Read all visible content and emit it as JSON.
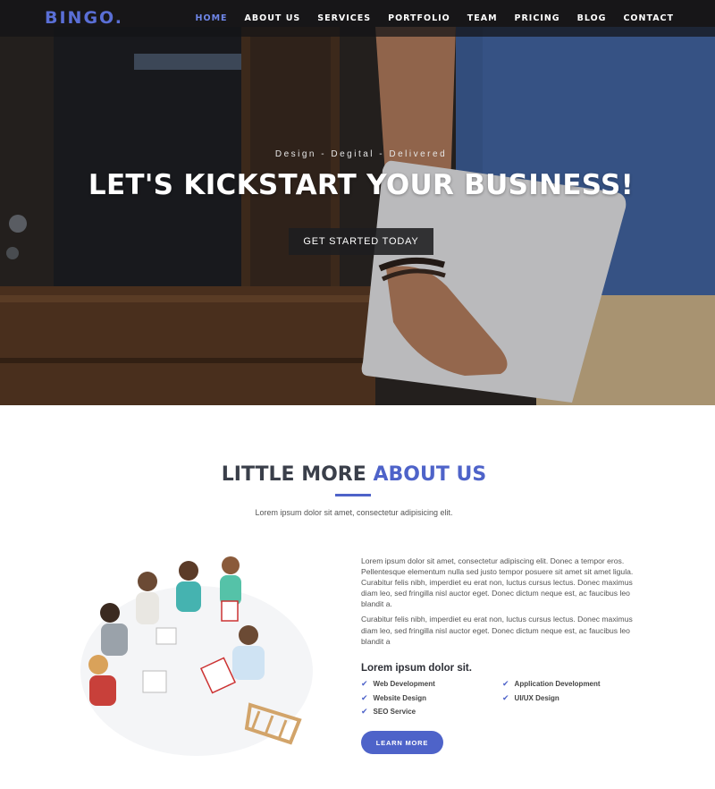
{
  "brand": {
    "logo": "BINGO.",
    "accent_color": "#4e63c9"
  },
  "nav": {
    "items": [
      {
        "label": "HOME",
        "active": true
      },
      {
        "label": "ABOUT US",
        "active": false
      },
      {
        "label": "SERVICES",
        "active": false
      },
      {
        "label": "PORTFOLIO",
        "active": false
      },
      {
        "label": "TEAM",
        "active": false
      },
      {
        "label": "PRICING",
        "active": false
      },
      {
        "label": "BLOG",
        "active": false
      },
      {
        "label": "CONTACT",
        "active": false
      }
    ]
  },
  "hero": {
    "tagline": "Design - Degital - Delivered",
    "headline": "LET'S KICKSTART YOUR BUSINESS!",
    "cta_label": "GET STARTED TODAY"
  },
  "about": {
    "title_prefix": "LITTLE MORE",
    "title_accent": "ABOUT US",
    "subtitle": "Lorem ipsum dolor sit amet, consectetur adipisicing elit.",
    "paragraphs": [
      "Lorem ipsum dolor sit amet, consectetur adipiscing elit. Donec a tempor eros. Pellentesque elementum nulla sed justo tempor posuere sit amet sit amet ligula. Curabitur felis nibh, imperdiet eu erat non, luctus cursus lectus. Donec maximus diam leo, sed fringilla nisl auctor eget. Donec dictum neque est, ac faucibus leo blandit a.",
      "Curabitur felis nibh, imperdiet eu erat non, luctus cursus lectus. Donec maximus diam leo, sed fringilla nisl auctor eget. Donec dictum neque est, ac faucibus leo blandit a"
    ],
    "list_heading": "Lorem ipsum dolor sit.",
    "features": [
      "Web Development",
      "Application Development",
      "Website Design",
      "UI/UX Design",
      "SEO Service"
    ],
    "learn_more_label": "LEARN MORE"
  }
}
